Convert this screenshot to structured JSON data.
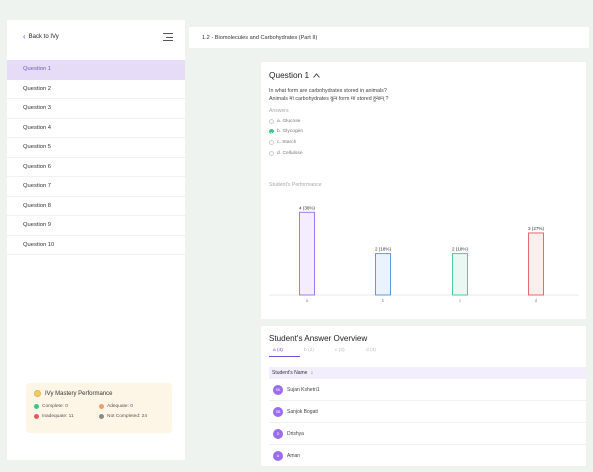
{
  "sidebar": {
    "back_label": "Back to IVy",
    "questions": [
      "Question 1",
      "Question 2",
      "Question 3",
      "Question 4",
      "Question 5",
      "Question 6",
      "Question 7",
      "Question 8",
      "Question 9",
      "Question 10"
    ],
    "active_index": 0
  },
  "mastery": {
    "title": "IVy Mastery Performance",
    "complete": "Complete: 0",
    "adequate": "Adequate: 0",
    "inadequate": "Inadequate: 11",
    "not_completed": "Not Completed: 24",
    "colors": {
      "complete": "#39c787",
      "adequate": "#f29b6b",
      "inadequate": "#e35b5b",
      "not_completed": "#8a8a8a"
    }
  },
  "topbar": {
    "title": "1.2 - Biomolecules and Carbohydrates (Part II)"
  },
  "question": {
    "title": "Question 1",
    "text_en": "In what form are carbohydrates stored in animals?",
    "text_np": "Animals मा carbohydrates कुन form मा stored हुन्छन् ?",
    "answers_label": "Answers",
    "options": [
      {
        "label": "a. Glucose",
        "correct": false
      },
      {
        "label": "b. Glycogen",
        "correct": true
      },
      {
        "label": "c. Starch",
        "correct": false
      },
      {
        "label": "d. Cellulose",
        "correct": false
      }
    ]
  },
  "performance": {
    "label": "Student's Performance"
  },
  "chart_data": {
    "type": "bar",
    "categories": [
      "a",
      "b",
      "c",
      "d"
    ],
    "values": [
      4,
      2,
      2,
      3
    ],
    "data_labels": [
      "4 (36%)",
      "2 (18%)",
      "2 (18%)",
      "3 (27%)"
    ],
    "ylim": [
      0,
      4.4
    ],
    "colors": [
      "#9b6cf0",
      "#4a8fe0",
      "#39c79a",
      "#e35b5b"
    ],
    "fills": [
      "#f3edfd",
      "#eaf2fc",
      "#e9f8f2",
      "#fdeeee"
    ]
  },
  "overview": {
    "title": "Student's Answer Overview",
    "tabs": [
      "a (4)",
      "b (2)",
      "c (2)",
      "d (3)"
    ],
    "active_tab": 0,
    "column_header": "Student's Name",
    "students": [
      {
        "initials": "SK",
        "name": "Sujan Kshetri1"
      },
      {
        "initials": "SB",
        "name": "Sanjok Bogati"
      },
      {
        "initials": "D",
        "name": "Drishya"
      },
      {
        "initials": "A",
        "name": "Aman"
      }
    ]
  }
}
